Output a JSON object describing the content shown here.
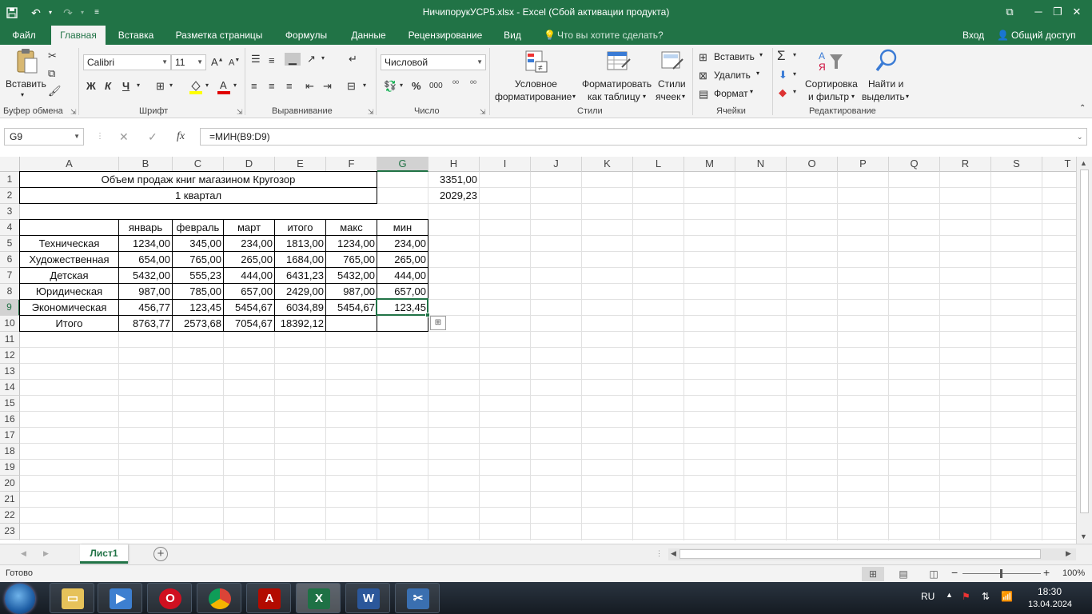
{
  "window": {
    "title": "НичипорукУСР5.xlsx - Excel (Сбой активации продукта)",
    "qat": {
      "save": "save-icon",
      "undo": "undo-icon",
      "redo": "redo-icon"
    }
  },
  "tabs": [
    {
      "label": "Файл"
    },
    {
      "label": "Главная"
    },
    {
      "label": "Вставка"
    },
    {
      "label": "Разметка страницы"
    },
    {
      "label": "Формулы"
    },
    {
      "label": "Данные"
    },
    {
      "label": "Рецензирование"
    },
    {
      "label": "Вид"
    }
  ],
  "tell_me": "Что вы хотите сделать?",
  "signin": "Вход",
  "share": "Общий доступ",
  "ribbon": {
    "clipboard": {
      "paste": "Вставить",
      "label": "Буфер обмена"
    },
    "font": {
      "name": "Calibri",
      "size": "11",
      "bold": "Ж",
      "italic": "К",
      "underline": "Ч",
      "label": "Шрифт"
    },
    "alignment": {
      "label": "Выравнивание"
    },
    "number": {
      "format": "Числовой",
      "percent": "%",
      "thousands": "000",
      "label": "Число"
    },
    "styles": {
      "conditional_1": "Условное",
      "conditional_2": "форматирование",
      "table_1": "Форматировать",
      "table_2": "как таблицу",
      "cell_1": "Стили",
      "cell_2": "ячеек",
      "label": "Стили"
    },
    "cells": {
      "insert": "Вставить",
      "delete": "Удалить",
      "format": "Формат",
      "label": "Ячейки"
    },
    "editing": {
      "sort_1": "Сортировка",
      "sort_2": "и фильтр",
      "find_1": "Найти и",
      "find_2": "выделить",
      "label": "Редактирование"
    }
  },
  "formula_bar": {
    "name_box": "G9",
    "fx": "fx",
    "formula": "=МИН(B9:D9)"
  },
  "columns": [
    "A",
    "B",
    "C",
    "D",
    "E",
    "F",
    "G",
    "H",
    "I",
    "J",
    "K",
    "L",
    "M",
    "N",
    "O",
    "P",
    "Q",
    "R",
    "S",
    "T"
  ],
  "rows": [
    "1",
    "2",
    "3",
    "4",
    "5",
    "6",
    "7",
    "8",
    "9",
    "10",
    "11",
    "12",
    "13",
    "14",
    "15",
    "16",
    "17",
    "18",
    "19",
    "20",
    "21",
    "22",
    "23"
  ],
  "sheet": {
    "title": "Объем продаж книг магазином Кругозор",
    "subtitle": "1 квартал",
    "h1": "3351,00",
    "h2": "2029,23",
    "headers": [
      "январь",
      "февраль",
      "март",
      "итого",
      "макс",
      "мин"
    ],
    "data": [
      {
        "name": "Техническая",
        "values": [
          "1234,00",
          "345,00",
          "234,00",
          "1813,00",
          "1234,00",
          "234,00"
        ]
      },
      {
        "name": "Художественная",
        "values": [
          "654,00",
          "765,00",
          "265,00",
          "1684,00",
          "765,00",
          "265,00"
        ]
      },
      {
        "name": "Детская",
        "values": [
          "5432,00",
          "555,23",
          "444,00",
          "6431,23",
          "5432,00",
          "444,00"
        ]
      },
      {
        "name": "Юридическая",
        "values": [
          "987,00",
          "785,00",
          "657,00",
          "2429,00",
          "987,00",
          "657,00"
        ]
      },
      {
        "name": "Экономическая",
        "values": [
          "456,77",
          "123,45",
          "5454,67",
          "6034,89",
          "5454,67",
          "123,45"
        ]
      }
    ],
    "total": {
      "name": "Итого",
      "values": [
        "8763,77",
        "2573,68",
        "7054,67",
        "18392,12"
      ]
    }
  },
  "sheet_tab": "Лист1",
  "status": {
    "ready": "Готово",
    "zoom": "100%"
  },
  "tray": {
    "lang": "RU",
    "time": "18:30",
    "date": "13.04.2024"
  },
  "colors": {
    "accent": "#217346"
  }
}
